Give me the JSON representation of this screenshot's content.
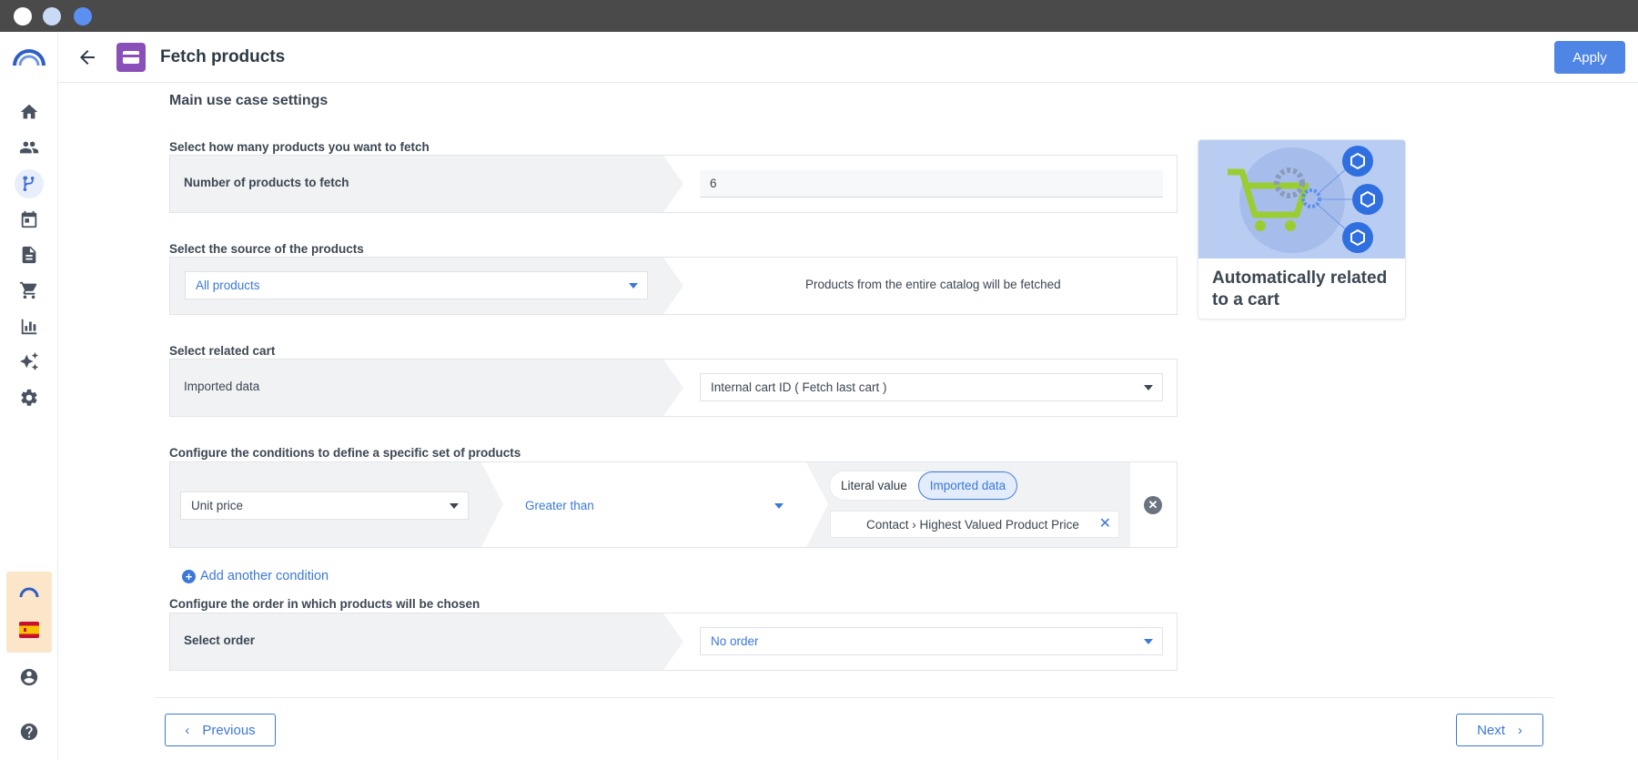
{
  "header": {
    "title": "Fetch products",
    "apply_label": "Apply"
  },
  "sidebar": {
    "items": [
      {
        "icon": "home-icon"
      },
      {
        "icon": "people-icon"
      },
      {
        "icon": "workflow-icon",
        "active": true
      },
      {
        "icon": "calendar-icon"
      },
      {
        "icon": "document-icon"
      },
      {
        "icon": "cart-icon"
      },
      {
        "icon": "bar-chart-icon"
      },
      {
        "icon": "sparkle-icon"
      },
      {
        "icon": "gear-icon"
      }
    ],
    "bottom": [
      {
        "icon": "account-icon"
      },
      {
        "icon": "help-icon"
      }
    ]
  },
  "main": {
    "section_title": "Main use case settings",
    "count": {
      "label": "Select how many products you want to fetch",
      "row_label": "Number of products to fetch",
      "value": "6"
    },
    "source": {
      "label": "Select the source of the products",
      "selected": "All products",
      "description": "Products from the entire catalog will be fetched"
    },
    "cart": {
      "label": "Select related cart",
      "row_label": "Imported data",
      "selected": "Internal cart ID ( Fetch last cart )"
    },
    "conditions": {
      "label": "Configure the conditions to define a specific set of products",
      "field": "Unit price",
      "operator": "Greater than",
      "toggle_literal": "Literal value",
      "toggle_imported": "Imported data",
      "value": "Contact › Highest Valued Product Price",
      "add_label": "Add another condition"
    },
    "order": {
      "label": "Configure the order in which products will be chosen",
      "row_label": "Select order",
      "selected": "No order"
    }
  },
  "info_card": {
    "text": "Automatically related to a cart"
  },
  "footer": {
    "previous_label": "Previous",
    "next_label": "Next"
  }
}
